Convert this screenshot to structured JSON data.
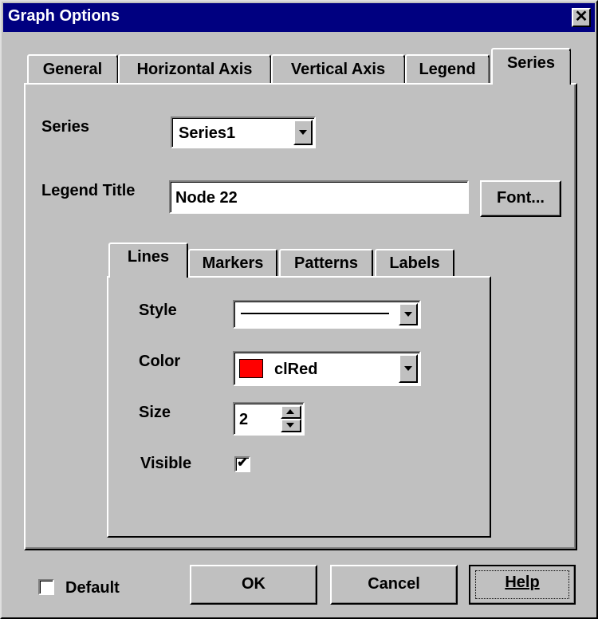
{
  "window": {
    "title": "Graph Options",
    "close_glyph": "✕"
  },
  "tabs": [
    {
      "label": "General"
    },
    {
      "label": "Horizontal Axis"
    },
    {
      "label": "Vertical Axis"
    },
    {
      "label": "Legend"
    },
    {
      "label": "Series",
      "active": true
    }
  ],
  "series_panel": {
    "series_label": "Series",
    "series_value": "Series1",
    "legend_title_label": "Legend Title",
    "legend_title_value": "Node 22",
    "font_button": "Font..."
  },
  "sub_tabs": [
    {
      "label": "Lines",
      "active": true
    },
    {
      "label": "Markers"
    },
    {
      "label": "Patterns"
    },
    {
      "label": "Labels"
    }
  ],
  "lines": {
    "style_label": "Style",
    "color_label": "Color",
    "color_value": "clRed",
    "color_swatch": "#ff0000",
    "size_label": "Size",
    "size_value": "2",
    "visible_label": "Visible",
    "visible_checked": true
  },
  "footer": {
    "default_label": "Default",
    "default_checked": false,
    "ok_label": "OK",
    "cancel_label": "Cancel",
    "help_label": "Help"
  }
}
